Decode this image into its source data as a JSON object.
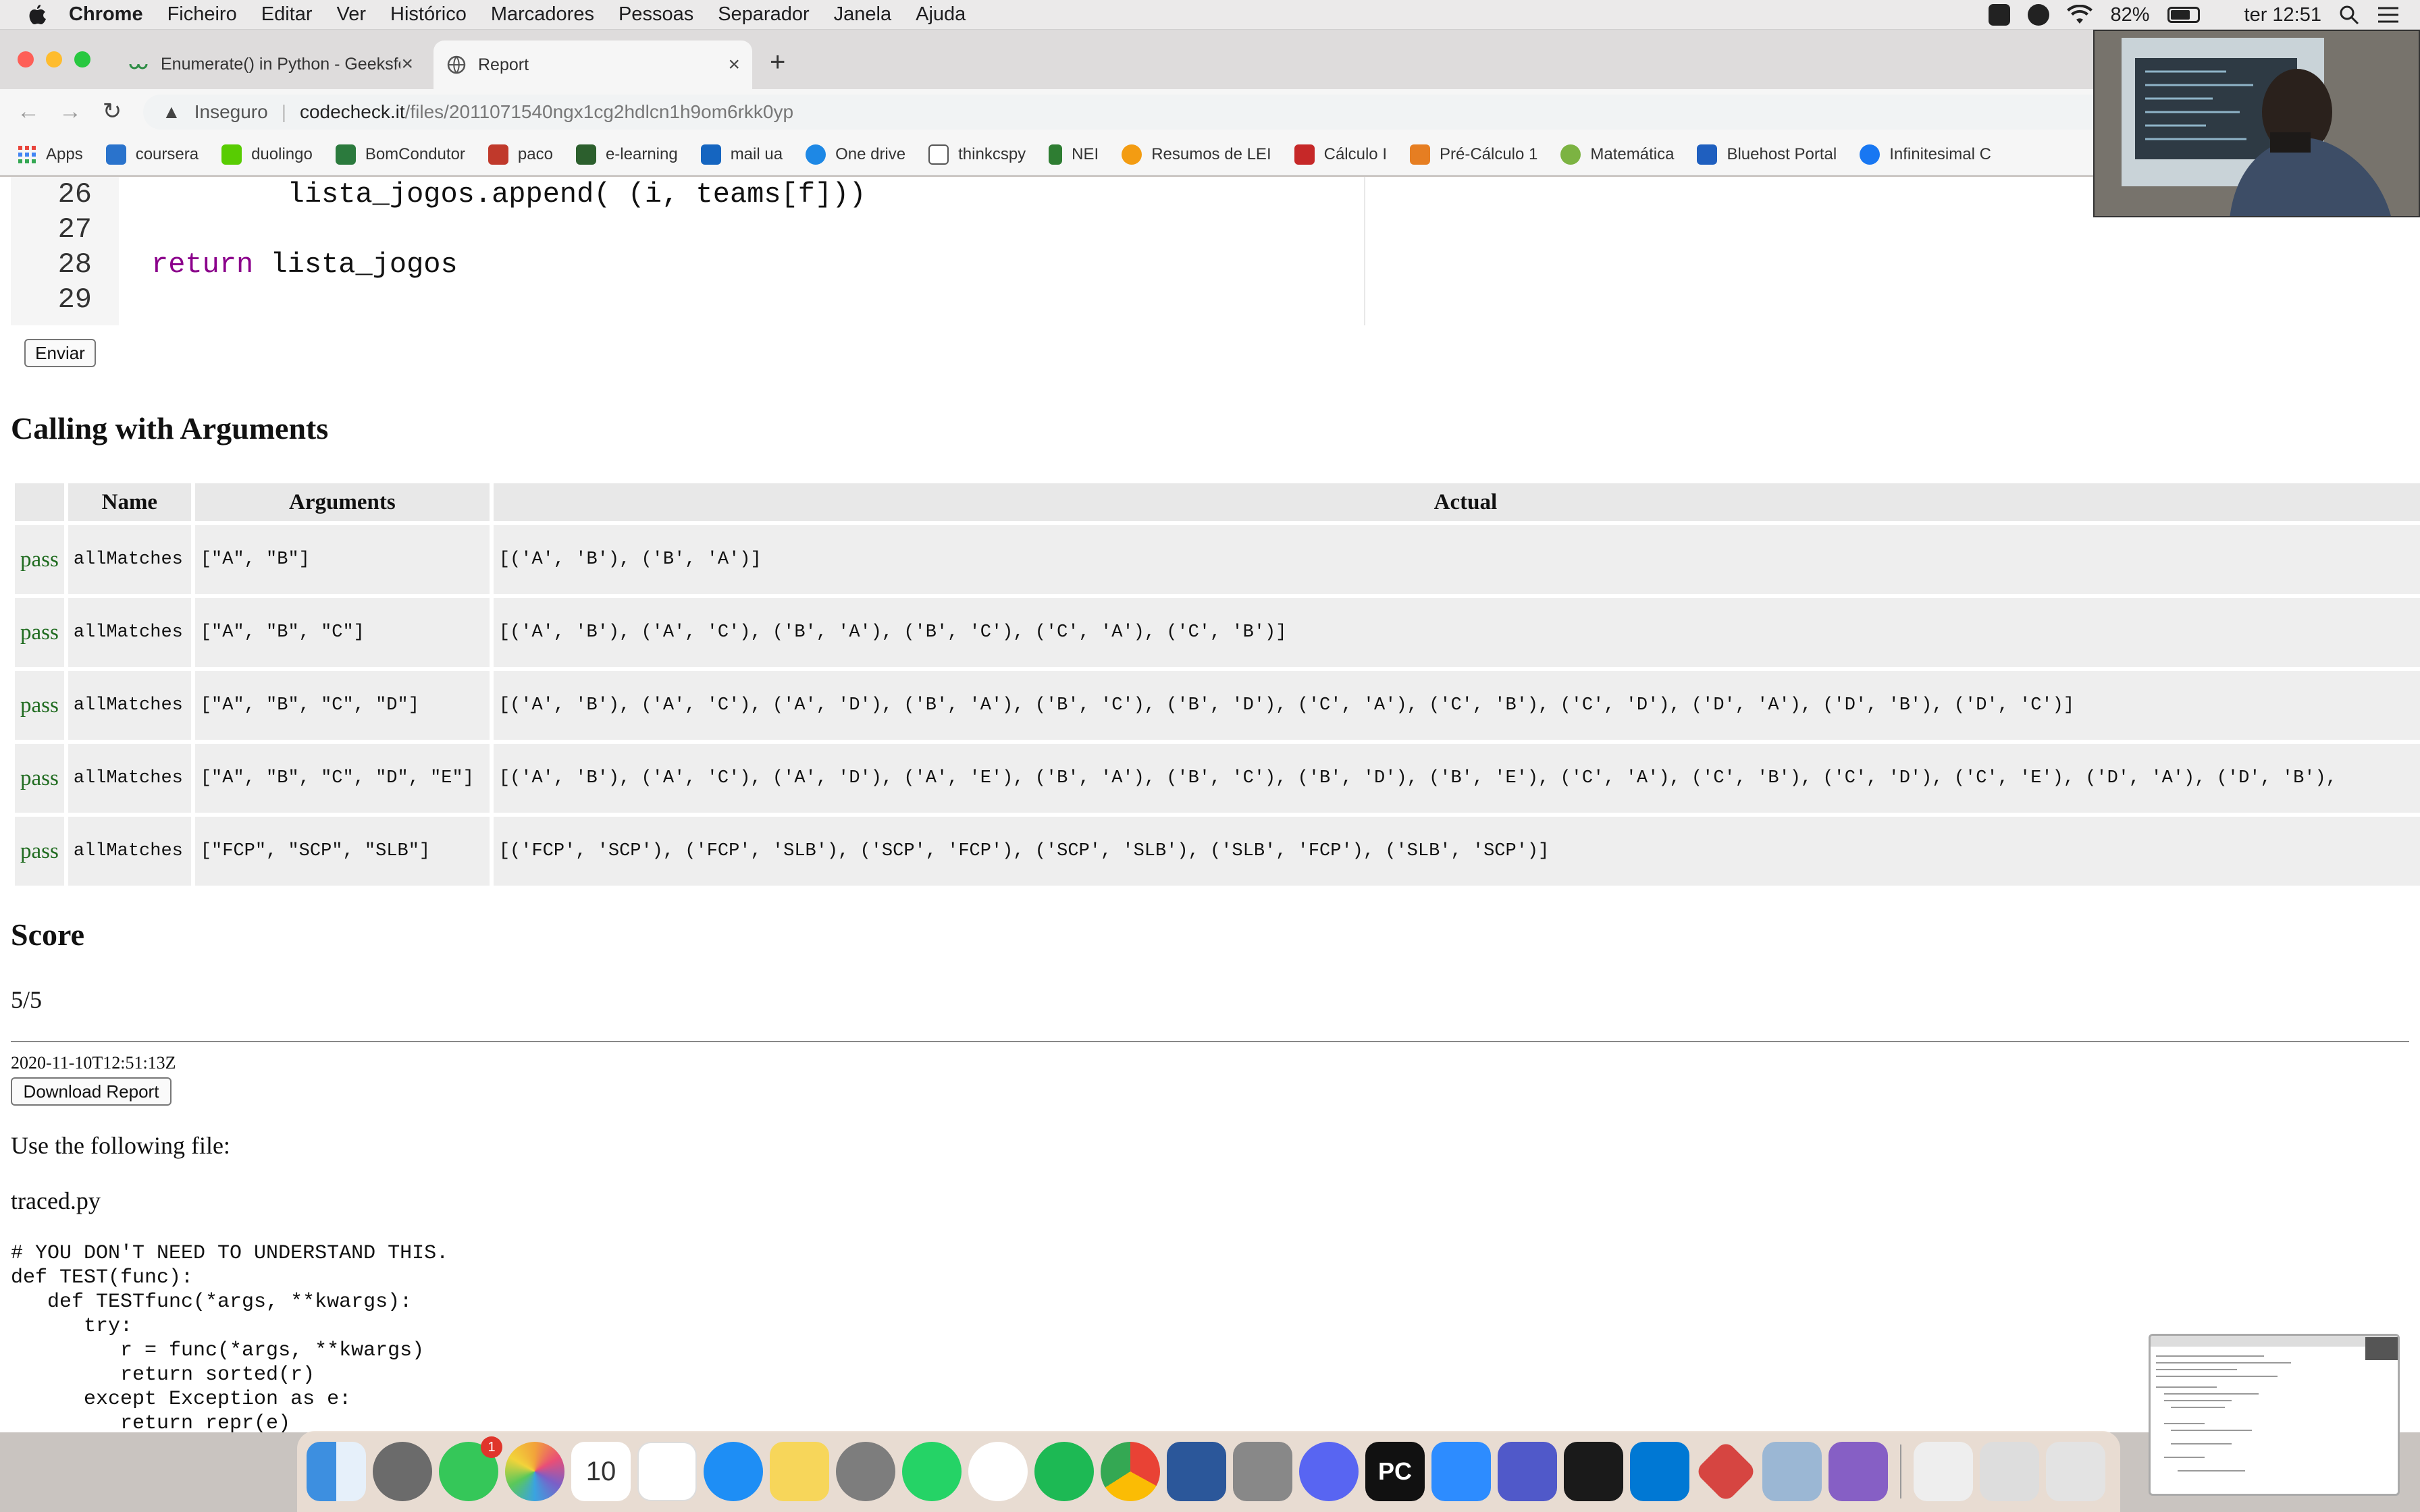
{
  "menubar": {
    "app_name": "Chrome",
    "items": [
      "Ficheiro",
      "Editar",
      "Ver",
      "Histórico",
      "Marcadores",
      "Pessoas",
      "Separador",
      "Janela",
      "Ajuda"
    ],
    "battery": "82%",
    "clock": "ter 12:51"
  },
  "tabs": [
    {
      "title": "Enumerate() in Python - GeeksforGeeks",
      "close": "×"
    },
    {
      "title": "Report",
      "close": "×"
    }
  ],
  "new_tab": "+",
  "omnibox": {
    "security": "Inseguro",
    "separator": "|",
    "host": "codecheck.it",
    "path": "/files/2011071540ngx1cg2hdlcn1h9om6rkk0yp"
  },
  "nav": {
    "back": "←",
    "forward": "→",
    "reload": "↻",
    "warning": "▲"
  },
  "bookmarks": [
    {
      "label": "Apps",
      "color": "#e8453c"
    },
    {
      "label": "coursera",
      "color": "#2a73cc"
    },
    {
      "label": "duolingo",
      "color": "#58cc02"
    },
    {
      "label": "BomCondutor",
      "color": "#2b7a3d"
    },
    {
      "label": "paco",
      "color": "#c0392b"
    },
    {
      "label": "e-learning",
      "color": "#2c5f2d"
    },
    {
      "label": "mail ua",
      "color": "#1565c0"
    },
    {
      "label": "One drive",
      "color": "#1e88e5"
    },
    {
      "label": "thinkcspy",
      "color": "#555555"
    },
    {
      "label": "NEI",
      "color": "#2e7d32"
    },
    {
      "label": "Resumos de LEI",
      "color": "#f39c12"
    },
    {
      "label": "Cálculo I",
      "color": "#c62828"
    },
    {
      "label": "Pré-Cálculo 1",
      "color": "#e67e22"
    },
    {
      "label": "Matemática",
      "color": "#7cb342"
    },
    {
      "label": "Bluehost Portal",
      "color": "#1f5fbf"
    },
    {
      "label": "Infinitesimal C",
      "color": "#1877f2"
    }
  ],
  "code": {
    "lines": [
      {
        "n": "26",
        "indent": "        ",
        "kw": "",
        "text": "lista_jogos.append( (i, teams[f]))"
      },
      {
        "n": "27",
        "indent": "",
        "kw": "",
        "text": ""
      },
      {
        "n": "28",
        "indent": "",
        "kw": "return",
        "text": " lista_jogos"
      },
      {
        "n": "29",
        "indent": "",
        "kw": "",
        "text": ""
      }
    ],
    "submit_label": "Enviar"
  },
  "calling": {
    "heading": "Calling with Arguments",
    "headers": [
      "",
      "Name",
      "Arguments",
      "Actual"
    ],
    "rows": [
      {
        "status": "pass",
        "name": "allMatches",
        "args": "[\"A\", \"B\"]",
        "actual": "[('A', 'B'), ('B', 'A')]"
      },
      {
        "status": "pass",
        "name": "allMatches",
        "args": "[\"A\", \"B\", \"C\"]",
        "actual": "[('A', 'B'), ('A', 'C'), ('B', 'A'), ('B', 'C'), ('C', 'A'), ('C', 'B')]"
      },
      {
        "status": "pass",
        "name": "allMatches",
        "args": "[\"A\", \"B\", \"C\", \"D\"]",
        "actual": "[('A', 'B'), ('A', 'C'), ('A', 'D'), ('B', 'A'), ('B', 'C'), ('B', 'D'), ('C', 'A'), ('C', 'B'), ('C', 'D'), ('D', 'A'), ('D', 'B'), ('D', 'C')]"
      },
      {
        "status": "pass",
        "name": "allMatches",
        "args": "[\"A\", \"B\", \"C\", \"D\", \"E\"]",
        "actual": "[('A', 'B'), ('A', 'C'), ('A', 'D'), ('A', 'E'), ('B', 'A'), ('B', 'C'), ('B', 'D'), ('B', 'E'), ('C', 'A'), ('C', 'B'), ('C', 'D'), ('C', 'E'), ('D', 'A'), ('D', 'B'),"
      },
      {
        "status": "pass",
        "name": "allMatches",
        "args": "[\"FCP\", \"SCP\", \"SLB\"]",
        "actual": "[('FCP', 'SCP'), ('FCP', 'SLB'), ('SCP', 'FCP'), ('SCP', 'SLB'), ('SLB', 'FCP'), ('SLB', 'SCP')]"
      }
    ]
  },
  "score": {
    "heading": "Score",
    "value": "5/5"
  },
  "report": {
    "timestamp": "2020-11-10T12:51:13Z",
    "download_label": "Download Report",
    "use_file_text": "Use the following file:",
    "filename": "traced.py",
    "source": [
      "# YOU DON'T NEED TO UNDERSTAND THIS.",
      "def TEST(func):",
      "   def TESTfunc(*args, **kwargs):",
      "      try:",
      "         r = func(*args, **kwargs)",
      "         return sorted(r)",
      "      except Exception as e:",
      "         return repr(e)"
    ]
  },
  "dock": {
    "apps": [
      {
        "name": "finder",
        "color": "#3d8fe0"
      },
      {
        "name": "launchpad",
        "color": "#6b6b6b"
      },
      {
        "name": "messages",
        "color": "#35c759",
        "badge": "1"
      },
      {
        "name": "photos",
        "color": "#f2a33a"
      },
      {
        "name": "calendar",
        "color": "#ffffff",
        "text": "10"
      },
      {
        "name": "reminders",
        "color": "#ffffff"
      },
      {
        "name": "app-store",
        "color": "#1e8ef5"
      },
      {
        "name": "notes",
        "color": "#f7d65a"
      },
      {
        "name": "system-preferences",
        "color": "#7d7d7d"
      },
      {
        "name": "whatsapp",
        "color": "#25d366"
      },
      {
        "name": "slack",
        "color": "#ffffff"
      },
      {
        "name": "spotify",
        "color": "#1db954"
      },
      {
        "name": "chrome",
        "color": "#e94235"
      },
      {
        "name": "word",
        "color": "#2b579a"
      },
      {
        "name": "calculator",
        "color": "#888888"
      },
      {
        "name": "discord",
        "color": "#5865f2"
      },
      {
        "name": "pycharm",
        "color": "#111111",
        "text": "PC"
      },
      {
        "name": "zoom",
        "color": "#2d8cff"
      },
      {
        "name": "teams",
        "color": "#5059c9"
      },
      {
        "name": "terminal",
        "color": "#1a1a1a"
      },
      {
        "name": "vscode",
        "color": "#0078d4"
      },
      {
        "name": "codecheck",
        "color": "#d64541"
      },
      {
        "name": "preview",
        "color": "#9bb7d4"
      },
      {
        "name": "visual-studio",
        "color": "#865fc5"
      },
      {
        "name": "archive",
        "color": "#eeeeee"
      },
      {
        "name": "downloads-stack",
        "color": "#dddddd"
      },
      {
        "name": "trash",
        "color": "#e3e3e3"
      }
    ]
  }
}
